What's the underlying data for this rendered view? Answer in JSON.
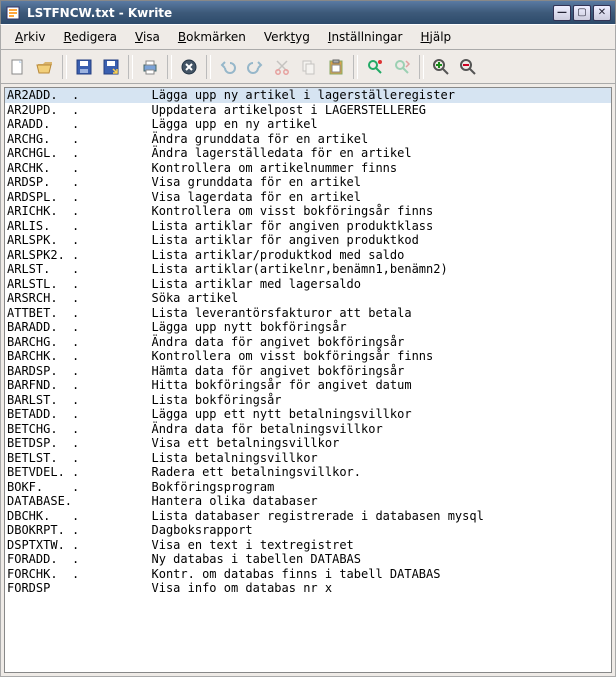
{
  "window": {
    "title": "LSTFNCW.txt - Kwrite"
  },
  "menu": {
    "items": [
      {
        "label": "Arkiv",
        "ul_index": 0
      },
      {
        "label": "Redigera",
        "ul_index": 0
      },
      {
        "label": "Visa",
        "ul_index": 0
      },
      {
        "label": "Bokmärken",
        "ul_index": 0
      },
      {
        "label": "Verktyg",
        "ul_index": 4
      },
      {
        "label": "Inställningar",
        "ul_index": 0
      },
      {
        "label": "Hjälp",
        "ul_index": 0
      }
    ]
  },
  "toolbar": {
    "groups": [
      [
        {
          "name": "new-icon",
          "shape": "new",
          "enabled": true
        },
        {
          "name": "open-icon",
          "shape": "open",
          "enabled": true
        }
      ],
      [
        {
          "name": "save-icon",
          "shape": "save",
          "enabled": true
        },
        {
          "name": "save-as-icon",
          "shape": "saveas",
          "enabled": true
        }
      ],
      [
        {
          "name": "print-icon",
          "shape": "print",
          "enabled": true
        }
      ],
      [
        {
          "name": "close-icon",
          "shape": "close",
          "enabled": true
        }
      ],
      [
        {
          "name": "undo-icon",
          "shape": "undo",
          "enabled": false
        },
        {
          "name": "redo-icon",
          "shape": "redo",
          "enabled": false
        },
        {
          "name": "cut-icon",
          "shape": "cut",
          "enabled": false
        },
        {
          "name": "copy-icon",
          "shape": "copy",
          "enabled": false
        },
        {
          "name": "paste-icon",
          "shape": "paste",
          "enabled": true
        }
      ],
      [
        {
          "name": "find-icon",
          "shape": "find",
          "enabled": true
        },
        {
          "name": "find-next-icon",
          "shape": "findnext",
          "enabled": false
        }
      ],
      [
        {
          "name": "zoom-in-icon",
          "shape": "zoomin",
          "enabled": true
        },
        {
          "name": "zoom-out-icon",
          "shape": "zoomout",
          "enabled": true
        }
      ]
    ]
  },
  "editor": {
    "selected_index": 0,
    "lines": [
      {
        "code": "AR2ADD.",
        "mark": ".",
        "desc": "Lägga upp ny artikel i lagerställeregister"
      },
      {
        "code": "AR2UPD.",
        "mark": ".",
        "desc": "Uppdatera artikelpost i LAGERSTELLEREG"
      },
      {
        "code": "ARADD.",
        "mark": ".",
        "desc": "Lägga upp en ny artikel"
      },
      {
        "code": "ARCHG.",
        "mark": ".",
        "desc": "Ändra grunddata för en artikel"
      },
      {
        "code": "ARCHGL.",
        "mark": ".",
        "desc": "Ändra lagerställedata för en artikel"
      },
      {
        "code": "ARCHK.",
        "mark": ".",
        "desc": "Kontrollera om artikelnummer finns"
      },
      {
        "code": "ARDSP.",
        "mark": ".",
        "desc": "Visa grunddata för en artikel"
      },
      {
        "code": "ARDSPL.",
        "mark": ".",
        "desc": "Visa lagerdata för en artikel"
      },
      {
        "code": "ARICHK.",
        "mark": ".",
        "desc": "Kontrollera om visst bokföringsår finns"
      },
      {
        "code": "ARLIS.",
        "mark": ".",
        "desc": "Lista artiklar för angiven produktklass"
      },
      {
        "code": "ARLSPK.",
        "mark": ".",
        "desc": "Lista artiklar för angiven produktkod"
      },
      {
        "code": "ARLSPK2.",
        "mark": ".",
        "desc": "Lista artiklar/produktkod med saldo"
      },
      {
        "code": "ARLST.",
        "mark": ".",
        "desc": "Lista artiklar(artikelnr,benämn1,benämn2)"
      },
      {
        "code": "ARLSTL.",
        "mark": ".",
        "desc": "Lista artiklar med lagersaldo"
      },
      {
        "code": "ARSRCH.",
        "mark": ".",
        "desc": "Söka artikel"
      },
      {
        "code": "ATTBET.",
        "mark": ".",
        "desc": "Lista leverantörsfakturor att betala"
      },
      {
        "code": "BARADD.",
        "mark": ".",
        "desc": "Lägga upp nytt bokföringsår"
      },
      {
        "code": "BARCHG.",
        "mark": ".",
        "desc": "Ändra data för angivet bokföringsår"
      },
      {
        "code": "BARCHK.",
        "mark": ".",
        "desc": "Kontrollera om visst bokföringsår finns"
      },
      {
        "code": "BARDSP.",
        "mark": ".",
        "desc": "Hämta data för angivet bokföringsår"
      },
      {
        "code": "BARFND.",
        "mark": ".",
        "desc": "Hitta bokföringsår för angivet datum"
      },
      {
        "code": "BARLST.",
        "mark": ".",
        "desc": "Lista bokföringsår"
      },
      {
        "code": "BETADD.",
        "mark": ".",
        "desc": "Lägga upp ett nytt betalningsvillkor"
      },
      {
        "code": "BETCHG.",
        "mark": ".",
        "desc": "Ändra data för betalningsvillkor"
      },
      {
        "code": "BETDSP.",
        "mark": ".",
        "desc": "Visa ett betalningsvillkor"
      },
      {
        "code": "BETLST.",
        "mark": ".",
        "desc": "Lista betalningsvillkor"
      },
      {
        "code": "BETVDEL.",
        "mark": ".",
        "desc": "Radera ett betalningsvillkor."
      },
      {
        "code": "BOKF.",
        "mark": ".",
        "desc": "Bokföringsprogram"
      },
      {
        "code": "DATABASE.",
        "mark": "",
        "desc": "Hantera olika databaser"
      },
      {
        "code": "DBCHK.",
        "mark": ".",
        "desc": "Lista databaser registrerade i databasen mysql"
      },
      {
        "code": "DBOKRPT.",
        "mark": ".",
        "desc": "Dagboksrapport"
      },
      {
        "code": "DSPTXTW.",
        "mark": ".",
        "desc": "Visa en text i textregistret"
      },
      {
        "code": "FORADD.",
        "mark": ".",
        "desc": "Ny databas i tabellen DATABAS"
      },
      {
        "code": "FORCHK.",
        "mark": ".",
        "desc": "Kontr. om databas finns i tabell DATABAS"
      },
      {
        "code": "FORDSP",
        "mark": "",
        "desc": "Visa info om databas nr x"
      }
    ]
  }
}
